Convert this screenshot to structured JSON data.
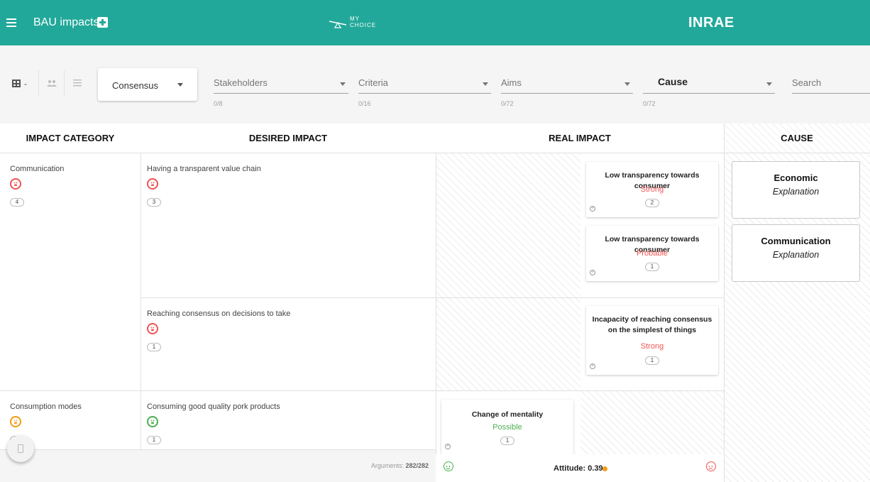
{
  "topbar": {
    "title": "BAU impacts",
    "logo_text": "MY\nCHOICE",
    "brand": "INRAE",
    "color": "#21a89a"
  },
  "toolbar": {
    "consensus_value": "Consensus",
    "filters": [
      {
        "label": "Stakeholders",
        "count": "0/8"
      },
      {
        "label": "Criteria",
        "count": "0/16"
      },
      {
        "label": "Aims",
        "count": "0/72"
      },
      {
        "label": "Cause",
        "count": "0/72"
      }
    ],
    "search_placeholder": "Search"
  },
  "table": {
    "headers": {
      "impact_category": "IMPACT CATEGORY",
      "desired_impact": "DESIRED IMPACT",
      "real_impact": "REAL IMPACT",
      "cause": "CAUSE"
    },
    "categories": [
      {
        "name": "Communication",
        "count": "4",
        "face": "red"
      },
      {
        "name": "Consumption modes",
        "count": "19",
        "face": "orange"
      }
    ],
    "desired": [
      {
        "name": "Having a transparent value chain",
        "count": "3",
        "face": "red"
      },
      {
        "name": "Reaching consensus on decisions to take",
        "count": "1",
        "face": "red"
      },
      {
        "name": "Consuming good quality pork products",
        "count": "1",
        "face": "green"
      }
    ],
    "real": [
      {
        "title": "Low transparency towards consumer",
        "level": "Strong",
        "level_color": "#f05454",
        "count": "2"
      },
      {
        "title": "Low transparency towards consumer",
        "level": "Probable",
        "level_color": "#f05454",
        "count": "1"
      },
      {
        "title": "Incapacity of reaching consensus on the simplest of things",
        "level": "Strong",
        "level_color": "#f05454",
        "count": "1"
      },
      {
        "title": "Change of mentality",
        "level": "Possible",
        "level_color": "#4caf50",
        "count": "1"
      }
    ],
    "causes": [
      {
        "title": "Economic",
        "subtitle": "Explanation"
      },
      {
        "title": "Communication",
        "subtitle": "Explanation"
      }
    ]
  },
  "footer": {
    "arguments_label": "Arguments:",
    "arguments_value": "282/282",
    "attitude": "Attitude: 0.39"
  }
}
